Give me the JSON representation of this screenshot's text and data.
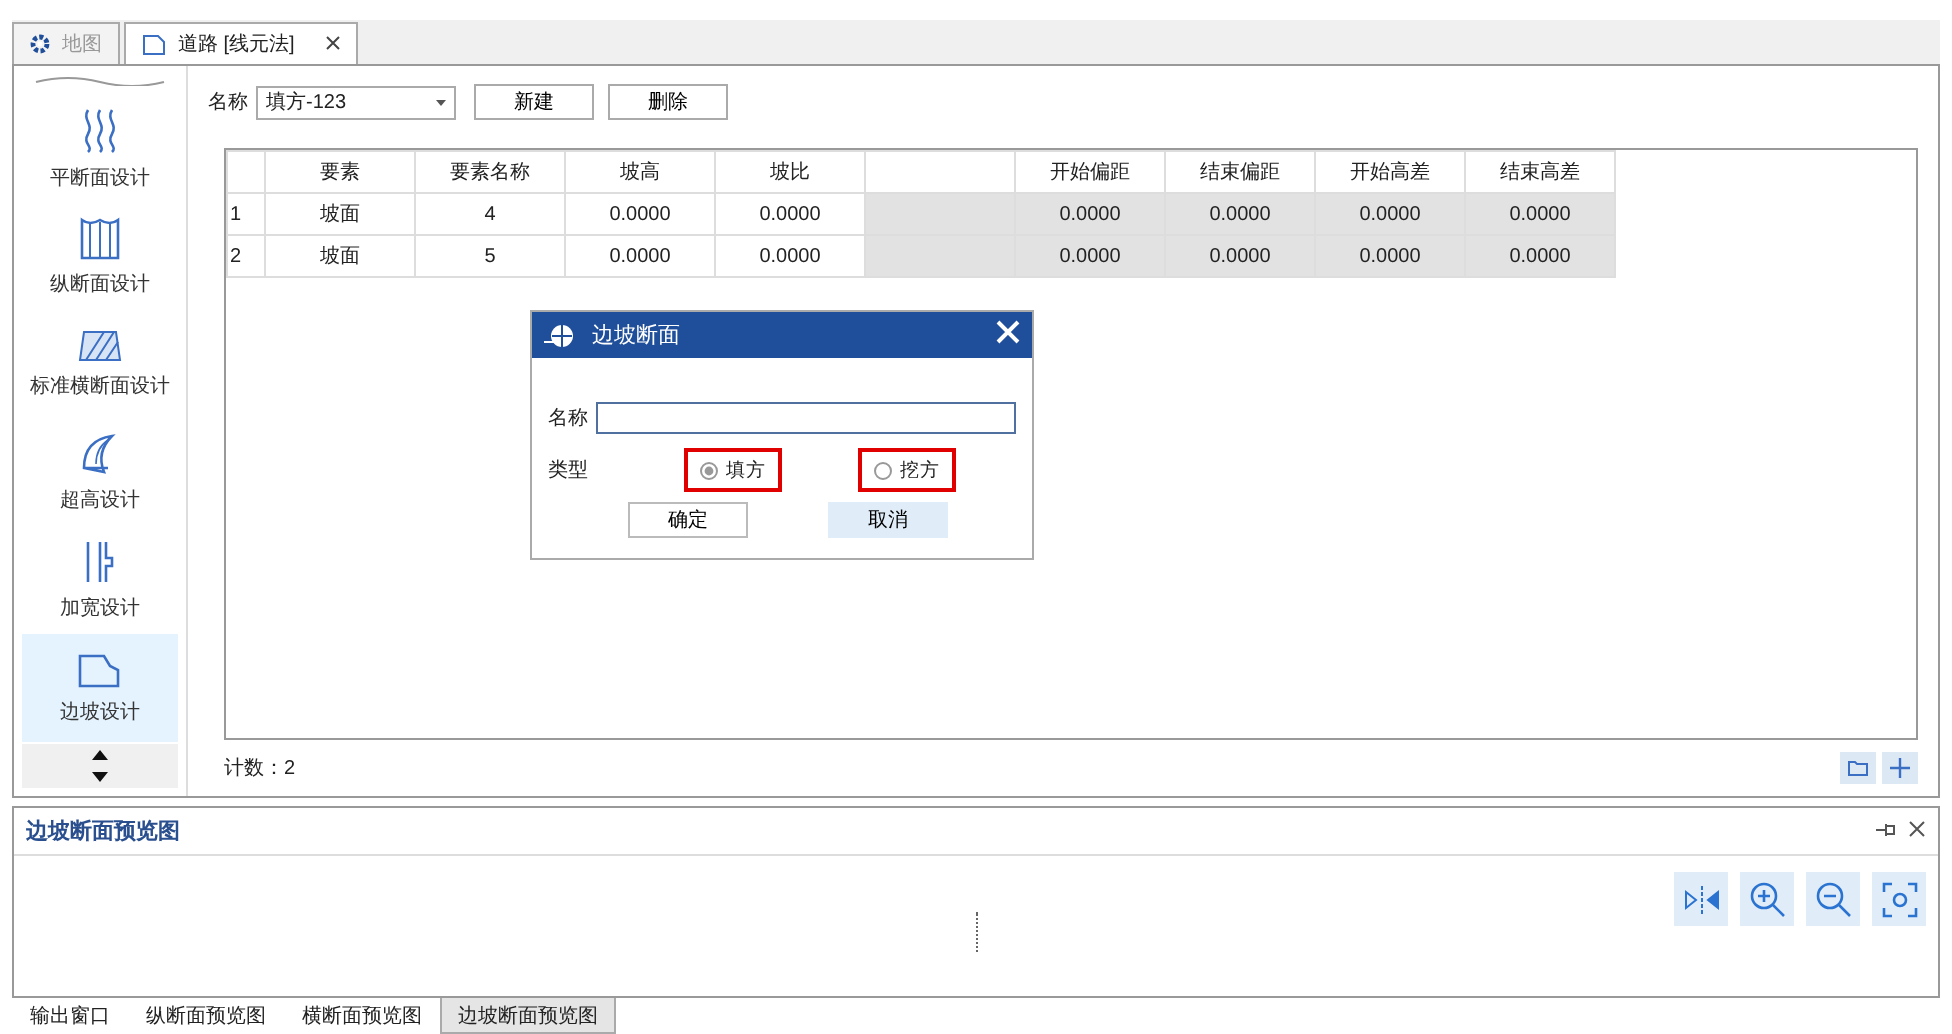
{
  "doc_tabs": [
    {
      "label": "地图",
      "selected": false,
      "closable": false
    },
    {
      "label": "道路 [线元法]",
      "selected": true,
      "closable": true
    }
  ],
  "sidebar": {
    "items": [
      {
        "label": "平断面设计",
        "selected": false
      },
      {
        "label": "纵断面设计",
        "selected": false
      },
      {
        "label": "标准横断面设计",
        "selected": false
      },
      {
        "label": "超高设计",
        "selected": false
      },
      {
        "label": "加宽设计",
        "selected": false
      },
      {
        "label": "边坡设计",
        "selected": true
      }
    ]
  },
  "toolbar": {
    "name_label": "名称",
    "name_value": "填方-123",
    "buttons": [
      "新建",
      "删除"
    ]
  },
  "table": {
    "columns": [
      {
        "label": "要素",
        "disabled": false
      },
      {
        "label": "要素名称",
        "disabled": false
      },
      {
        "label": "坡高",
        "disabled": false
      },
      {
        "label": "坡比",
        "disabled": false
      },
      {
        "disabled": true
      },
      {
        "label": "开始偏距",
        "disabled": true
      },
      {
        "label": "结束偏距",
        "disabled": true
      },
      {
        "label": "开始高差",
        "disabled": true
      },
      {
        "label": "结束高差",
        "disabled": true
      }
    ],
    "rows": [
      {
        "index": "1",
        "cells": [
          "坡面",
          "4",
          "0.0000",
          "0.0000",
          null,
          "0.0000",
          "0.0000",
          "0.0000",
          "0.0000"
        ]
      },
      {
        "index": "2",
        "cells": [
          "坡面",
          "5",
          "0.0000",
          "0.0000",
          null,
          "0.0000",
          "0.0000",
          "0.0000",
          "0.0000"
        ]
      }
    ]
  },
  "count": "计数：2",
  "dialog": {
    "title": "边坡断面",
    "name_label": "名称",
    "type_label": "类型",
    "radios": [
      {
        "label": "填方",
        "selected": true,
        "highlighted": true
      },
      {
        "label": "挖方",
        "selected": false,
        "highlighted": true
      }
    ],
    "buttons": [
      {
        "label": "确定",
        "hovered": false
      },
      {
        "label": "取消",
        "hovered": true
      }
    ]
  },
  "preview": {
    "title": "边坡断面预览图"
  },
  "bottom_tabs": [
    {
      "label": "输出窗口",
      "selected": false
    },
    {
      "label": "纵断面预览图",
      "selected": false
    },
    {
      "label": "横断面预览图",
      "selected": false
    },
    {
      "label": "边坡断面预览图",
      "selected": true
    }
  ]
}
